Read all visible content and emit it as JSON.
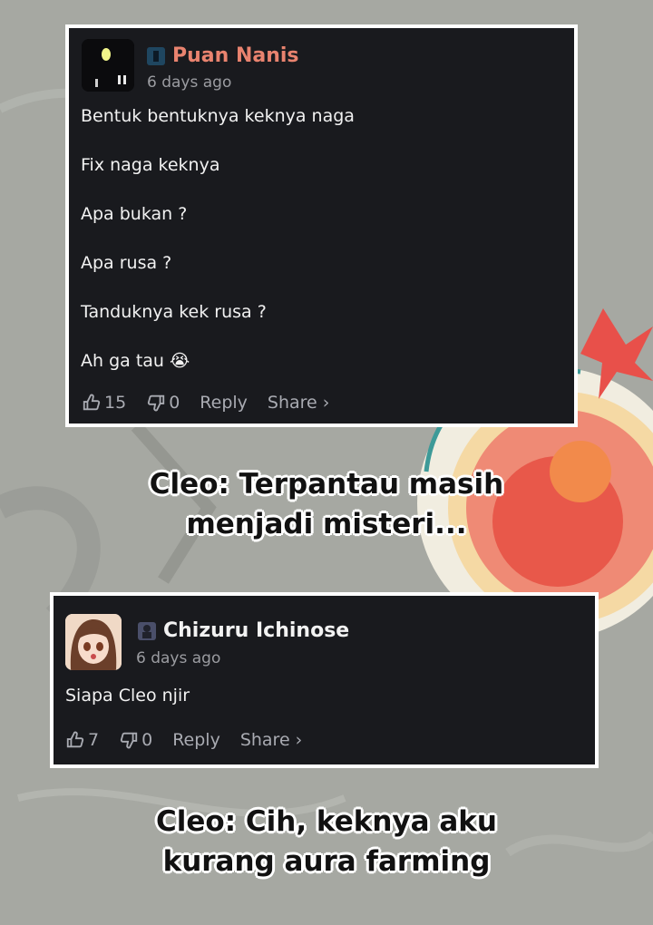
{
  "comments": [
    {
      "author": "Puan Nanis",
      "time": "6 days ago",
      "lines": [
        "Bentuk bentuknya keknya naga",
        "Fix naga keknya",
        "Apa bukan ?",
        "Apa rusa ?",
        "Tanduknya kek rusa ?",
        "Ah ga tau 😭"
      ],
      "likes": "15",
      "dislikes": "0",
      "reply_label": "Reply",
      "share_label": "Share ›",
      "name_color": "#e9836f"
    },
    {
      "author": "Chizuru Ichinose",
      "time": "6 days ago",
      "lines": [
        "Siapa Cleo njir"
      ],
      "likes": "7",
      "dislikes": "0",
      "reply_label": "Reply",
      "share_label": "Share ›",
      "name_color": "#f2f2f2"
    }
  ],
  "captions": [
    "Cleo: Terpantau masih menjadi misteri...",
    "Cleo: Cih, keknya aku kurang aura farming"
  ],
  "icons": [
    "thumbs-up-icon",
    "thumbs-down-icon",
    "user-badge-icon"
  ]
}
